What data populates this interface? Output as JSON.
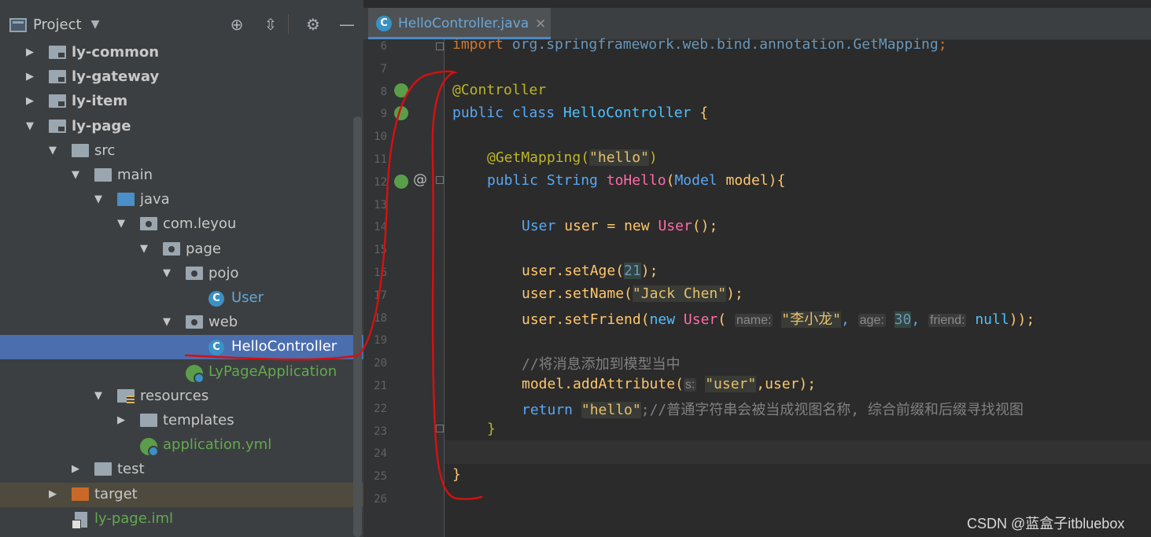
{
  "project_panel": {
    "title": "Project",
    "header_icons": [
      "locate-icon",
      "collapse-icon",
      "gear-icon",
      "minimize-icon"
    ],
    "tree": [
      {
        "label": "ly-common",
        "icon": "module-folder-icon",
        "expanded": false,
        "bold": true
      },
      {
        "label": "ly-gateway",
        "icon": "module-folder-icon",
        "expanded": false,
        "bold": true
      },
      {
        "label": "ly-item",
        "icon": "module-folder-icon",
        "expanded": false,
        "bold": true
      },
      {
        "label": "ly-page",
        "icon": "module-folder-icon",
        "expanded": true,
        "bold": true
      },
      {
        "label": "src",
        "icon": "folder-icon",
        "expanded": true
      },
      {
        "label": "main",
        "icon": "folder-icon",
        "expanded": true
      },
      {
        "label": "java",
        "icon": "source-folder-icon",
        "expanded": true
      },
      {
        "label": "com.leyou",
        "icon": "package-icon",
        "expanded": true
      },
      {
        "label": "page",
        "icon": "package-icon",
        "expanded": true
      },
      {
        "label": "pojo",
        "icon": "package-icon",
        "expanded": true
      },
      {
        "label": "User",
        "icon": "class-icon"
      },
      {
        "label": "web",
        "icon": "package-icon",
        "expanded": true
      },
      {
        "label": "HelloController",
        "icon": "class-icon",
        "selected": true
      },
      {
        "label": "LyPageApplication",
        "icon": "spring-boot-class-icon"
      },
      {
        "label": "resources",
        "icon": "resources-folder-icon",
        "expanded": true
      },
      {
        "label": "templates",
        "icon": "folder-icon",
        "expanded": false
      },
      {
        "label": "application.yml",
        "icon": "spring-config-icon"
      },
      {
        "label": "test",
        "icon": "folder-icon",
        "expanded": false
      },
      {
        "label": "target",
        "icon": "excluded-folder-icon",
        "expanded": false
      },
      {
        "label": "ly-page.iml",
        "icon": "iml-file-icon"
      }
    ]
  },
  "editor": {
    "tab": {
      "label": "HelloController.java",
      "close": "×",
      "icon_letter": "C"
    },
    "line_numbers": [
      "6",
      "7",
      "8",
      "9",
      "10",
      "11",
      "12",
      "13",
      "14",
      "15",
      "16",
      "17",
      "18",
      "19",
      "20",
      "21",
      "22",
      "23",
      "24",
      "25",
      "26"
    ],
    "code": {
      "l6_import": "import",
      "l6_pkg": "org.springframework.web.bind.annotation.GetMapping",
      "l6_semi": ";",
      "l8_ann": "@Controller",
      "l9_public": "public",
      "l9_class": "class",
      "l9_name": "HelloController",
      "l9_brace": "{",
      "l11_ann": "@GetMapping(",
      "l11_str": "\"hello\"",
      "l11_close": ")",
      "l12_public": "public",
      "l12_type": "String",
      "l12_method": "toHello",
      "l12_paren": "(",
      "l12_ptype": "Model",
      "l12_pname": "model",
      "l12_close": "){",
      "l14_type": "User",
      "l14_var": "user",
      "l14_eq": "=",
      "l14_new": "new",
      "l14_ctor": "User",
      "l14_end": "();",
      "l16_call": "user.setAge(",
      "l16_num": "21",
      "l16_end": ");",
      "l17_call": "user.setName(",
      "l17_str": "\"Jack Chen\"",
      "l17_end": ");",
      "l18_call": "user.setFriend(",
      "l18_new": "new",
      "l18_ctor": "User",
      "l18_paren": "(",
      "l18_hint_name": "name:",
      "l18_str": "\"李小龙\"",
      "l18_comma1": ",",
      "l18_hint_age": "age:",
      "l18_num": "30",
      "l18_comma2": ",",
      "l18_hint_friend": "friend:",
      "l18_null": "null",
      "l18_end": "));",
      "l20_comment": "//将消息添加到模型当中",
      "l21_call": "model.addAttribute(",
      "l21_hint": "s:",
      "l21_str": "\"user\"",
      "l21_end": ",user);",
      "l22_return": "return",
      "l22_str": "\"hello\"",
      "l22_comment": ";//普通字符串会被当成视图名称, 综合前缀和后缀寻找视图",
      "l23_brace": "}",
      "l25_brace": "}"
    },
    "gutter_icons": [
      "spring-bean-icon",
      "spring-bean-icon",
      "spring-mapping-icon",
      "at-icon"
    ],
    "at_symbol": "@"
  },
  "watermark": "CSDN @蓝盒子itbluebox",
  "colors": {
    "accent": "#4b6eaf",
    "annotation_red": "#d41010"
  }
}
